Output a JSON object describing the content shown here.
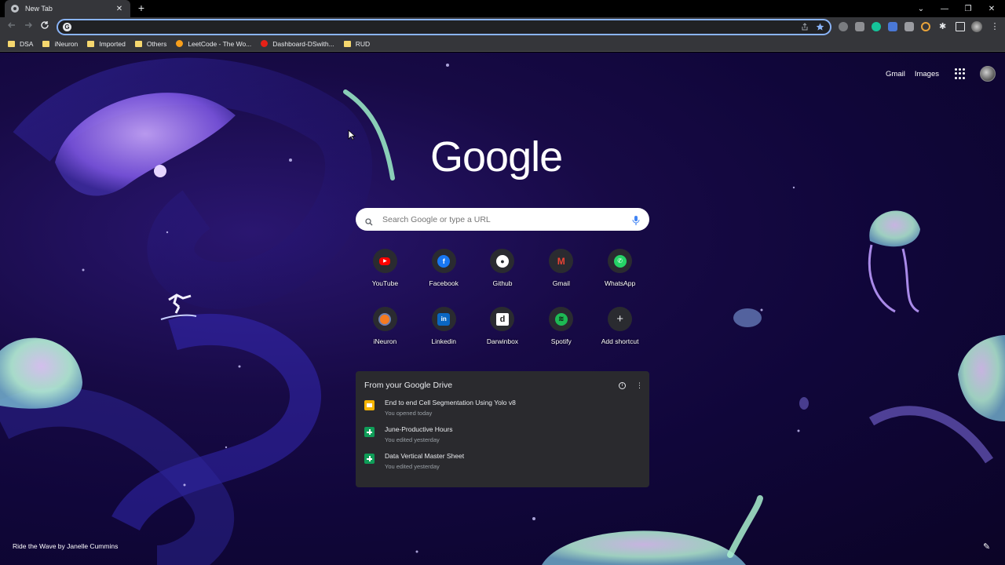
{
  "browser": {
    "tab_title": "New Tab",
    "tab_close": "✕",
    "new_tab": "+",
    "window_controls": [
      "⌄",
      "—",
      "❐",
      "✕"
    ],
    "omnibox_value": "",
    "omnibox_icon": "G"
  },
  "bookmarks": [
    {
      "label": "DSA",
      "icon": "folder"
    },
    {
      "label": "iNeuron",
      "icon": "folder"
    },
    {
      "label": "Imported",
      "icon": "folder"
    },
    {
      "label": "Others",
      "icon": "folder"
    },
    {
      "label": "LeetCode - The Wo...",
      "icon": "leetcode"
    },
    {
      "label": "Dashboard-DSwith...",
      "icon": "youtube"
    },
    {
      "label": "RUD",
      "icon": "folder"
    }
  ],
  "ntp": {
    "top_links": {
      "gmail": "Gmail",
      "images": "Images"
    },
    "logo": "Google",
    "search_placeholder": "Search Google or type a URL",
    "shortcuts": [
      {
        "label": "YouTube",
        "icon": "youtube-icon",
        "color": "#ff0000"
      },
      {
        "label": "Facebook",
        "icon": "facebook-icon",
        "color": "#1877f2"
      },
      {
        "label": "Github",
        "icon": "github-icon",
        "color": "#ffffff"
      },
      {
        "label": "Gmail",
        "icon": "gmail-icon",
        "color": "#ea4335"
      },
      {
        "label": "WhatsApp",
        "icon": "whatsapp-icon",
        "color": "#25d366"
      },
      {
        "label": "iNeuron",
        "icon": "ineuron-icon",
        "color": "#f47b20"
      },
      {
        "label": "Linkedin",
        "icon": "linkedin-icon",
        "color": "#0a66c2"
      },
      {
        "label": "Darwinbox",
        "icon": "darwinbox-icon",
        "color": "#ffffff"
      },
      {
        "label": "Spotify",
        "icon": "spotify-icon",
        "color": "#1db954"
      },
      {
        "label": "Add shortcut",
        "icon": "plus-icon",
        "color": "#e8eaed"
      }
    ],
    "drive": {
      "title": "From your Google Drive",
      "items": [
        {
          "name": "End to end Cell Segmentation Using Yolo v8",
          "sub": "You opened today",
          "type": "slides",
          "color": "#f4b400"
        },
        {
          "name": "June-Productive Hours",
          "sub": "You edited yesterday",
          "type": "sheets",
          "color": "#0f9d58"
        },
        {
          "name": "Data Vertical Master Sheet",
          "sub": "You edited yesterday",
          "type": "sheets",
          "color": "#0f9d58"
        }
      ]
    },
    "attribution": "Ride the Wave by Janelle Cummins"
  }
}
